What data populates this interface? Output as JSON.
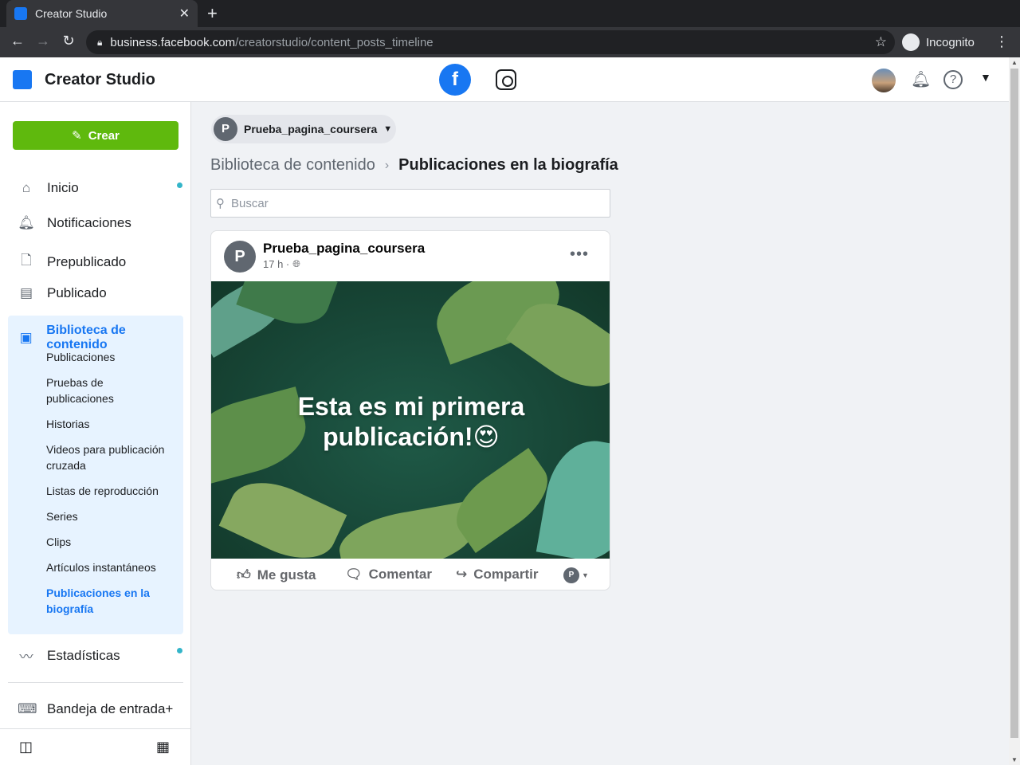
{
  "browser": {
    "tab_title": "Creator Studio",
    "tab_close": "✕",
    "new_tab": "+",
    "url_host": "business.facebook.com",
    "url_path": "/creatorstudio/content_posts_timeline",
    "incognito_label": "Incognito"
  },
  "header": {
    "app_title": "Creator Studio",
    "facebook_label": "f"
  },
  "sidebar": {
    "create_label": "Crear",
    "items": [
      {
        "label": "Inicio",
        "icon": "home-icon",
        "has_dot": true
      },
      {
        "label": "Notificaciones",
        "icon": "bell-icon"
      },
      {
        "label": "Prepublicado",
        "icon": "draft-icon"
      },
      {
        "label": "Publicado",
        "icon": "published-icon"
      }
    ],
    "library": {
      "label": "Biblioteca de contenido",
      "subitems": [
        "Publicaciones",
        "Pruebas de publicaciones",
        "Historias",
        "Videos para publicación cruzada",
        "Listas de reproducción",
        "Series",
        "Clips",
        "Artículos instantáneos",
        "Publicaciones en la biografía"
      ],
      "active": "Publicaciones en la biografía"
    },
    "stats_label": "Estadísticas",
    "inbox_label": "Bandeja de entrada+"
  },
  "main": {
    "page_selector": {
      "avatar_letter": "P",
      "name": "Prueba_pagina_coursera"
    },
    "breadcrumb": {
      "parent": "Biblioteca de contenido",
      "current": "Publicaciones en la biografía"
    },
    "search": {
      "placeholder": "Buscar",
      "value": ""
    },
    "post": {
      "avatar_letter": "P",
      "author": "Prueba_pagina_coursera",
      "time": "17 h ·",
      "caption_line1": "Esta es mi primera",
      "caption_line2": "publicación!😍",
      "actions": {
        "like": "Me gusta",
        "comment": "Comentar",
        "share": "Compartir"
      },
      "as_avatar_letter": "P"
    }
  },
  "colors": {
    "accent": "#1877f2",
    "create_green": "#5fb90d",
    "sidebar_active_bg": "#e7f3ff",
    "dot": "#34b5c9"
  }
}
